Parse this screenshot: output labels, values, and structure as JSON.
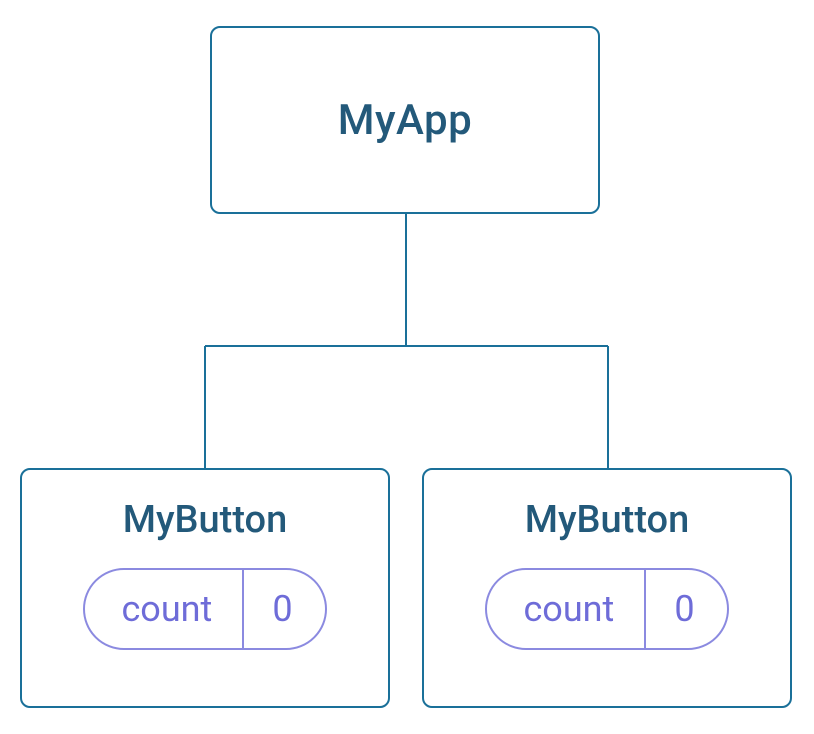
{
  "tree": {
    "root": {
      "label": "MyApp"
    },
    "children": [
      {
        "label": "MyButton",
        "state": {
          "name": "count",
          "value": "0"
        }
      },
      {
        "label": "MyButton",
        "state": {
          "name": "count",
          "value": "0"
        }
      }
    ]
  },
  "colors": {
    "node_border": "#1a7099",
    "text": "#23597a",
    "pill_border": "#8b8ae0",
    "pill_text": "#6e6cd8"
  }
}
